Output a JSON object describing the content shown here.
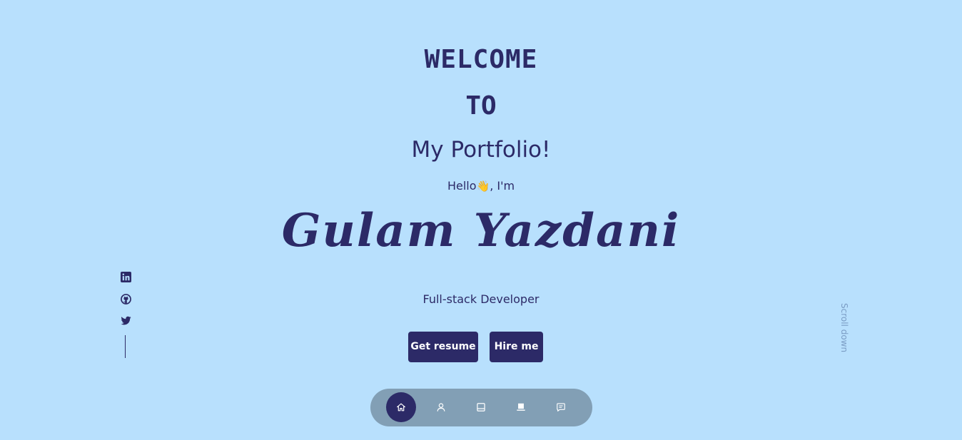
{
  "hero": {
    "welcome": "WELCOME",
    "to": "TO",
    "portfolio": "My Portfolio!",
    "hello_prefix": "Hello",
    "hello_emoji": "👋",
    "hello_suffix": ", I'm",
    "name": "Gulam Yazdani",
    "role": "Full-stack Developer"
  },
  "buttons": {
    "resume": "Get resume",
    "hire": "Hire me"
  },
  "socials": [
    "linkedin-icon",
    "github-icon",
    "twitter-icon"
  ],
  "scroll_label": "Scroll down",
  "nav": {
    "items": [
      "home-icon",
      "user-icon",
      "book-icon",
      "laptop-icon",
      "message-icon"
    ],
    "active": "home-icon"
  },
  "colors": {
    "background": "#b8e0fd",
    "primary": "#2c2a67",
    "nav_bg": "#829fb5",
    "scroll_text": "#7a9cc4"
  }
}
